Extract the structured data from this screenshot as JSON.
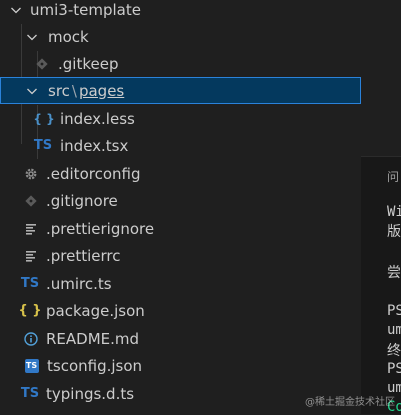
{
  "explorer": {
    "items": [
      {
        "label": "umi3-template",
        "icon": "chevron-down-icon"
      },
      {
        "label": "mock",
        "icon": "chevron-down-icon"
      },
      {
        "label": ".gitkeep",
        "icon": "git-icon"
      },
      {
        "label_parts": [
          "src",
          "\\",
          "pages"
        ],
        "icon": "chevron-down-icon",
        "selected": true
      },
      {
        "label": "index.less",
        "icon_text": "{ }",
        "icon": "less-icon"
      },
      {
        "label": "index.tsx",
        "icon_text": "TS",
        "icon": "ts-icon"
      },
      {
        "label": ".editorconfig",
        "icon": "gear-icon"
      },
      {
        "label": ".gitignore",
        "icon": "git-icon"
      },
      {
        "label": ".prettierignore",
        "icon": "lines-icon"
      },
      {
        "label": ".prettierrc",
        "icon": "lines-icon"
      },
      {
        "label": ".umirc.ts",
        "icon_text": "TS",
        "icon": "ts-icon"
      },
      {
        "label": "package.json",
        "icon_text": "{ }",
        "icon": "json-icon"
      },
      {
        "label": "README.md",
        "icon": "info-icon"
      },
      {
        "label": "tsconfig.json",
        "icon_text": "TS",
        "icon": "tsconfig-icon"
      },
      {
        "label": "typings.d.ts",
        "icon_text": "TS",
        "icon": "ts-icon"
      }
    ]
  },
  "terminal": {
    "tab_label": "问",
    "lines": [
      "Wi",
      "版",
      "尝",
      "PS",
      "um",
      "终",
      "PS",
      "um",
      "Co"
    ]
  },
  "watermark": "@稀土掘金技术社区",
  "colors": {
    "selection_bg": "#04395e",
    "selection_border": "#2a82da",
    "ts_blue": "#3178c6",
    "json_yellow": "#d8c24a",
    "terminal_green": "#23d18b"
  }
}
